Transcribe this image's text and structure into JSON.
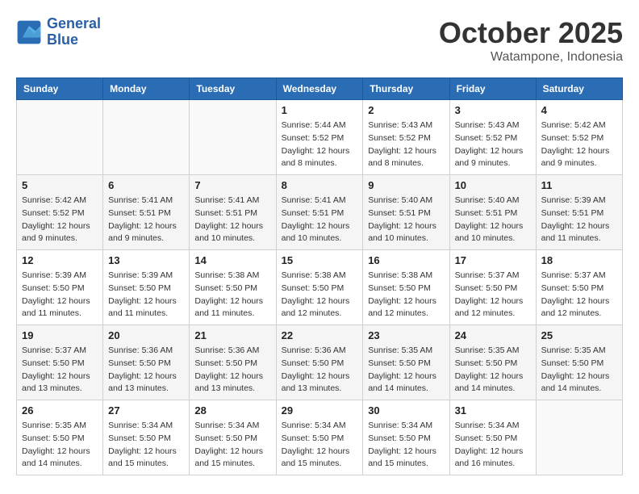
{
  "header": {
    "logo_line1": "General",
    "logo_line2": "Blue",
    "month_title": "October 2025",
    "location": "Watampone, Indonesia"
  },
  "weekdays": [
    "Sunday",
    "Monday",
    "Tuesday",
    "Wednesday",
    "Thursday",
    "Friday",
    "Saturday"
  ],
  "weeks": [
    [
      {
        "day": "",
        "info": ""
      },
      {
        "day": "",
        "info": ""
      },
      {
        "day": "",
        "info": ""
      },
      {
        "day": "1",
        "info": "Sunrise: 5:44 AM\nSunset: 5:52 PM\nDaylight: 12 hours\nand 8 minutes."
      },
      {
        "day": "2",
        "info": "Sunrise: 5:43 AM\nSunset: 5:52 PM\nDaylight: 12 hours\nand 8 minutes."
      },
      {
        "day": "3",
        "info": "Sunrise: 5:43 AM\nSunset: 5:52 PM\nDaylight: 12 hours\nand 9 minutes."
      },
      {
        "day": "4",
        "info": "Sunrise: 5:42 AM\nSunset: 5:52 PM\nDaylight: 12 hours\nand 9 minutes."
      }
    ],
    [
      {
        "day": "5",
        "info": "Sunrise: 5:42 AM\nSunset: 5:52 PM\nDaylight: 12 hours\nand 9 minutes."
      },
      {
        "day": "6",
        "info": "Sunrise: 5:41 AM\nSunset: 5:51 PM\nDaylight: 12 hours\nand 9 minutes."
      },
      {
        "day": "7",
        "info": "Sunrise: 5:41 AM\nSunset: 5:51 PM\nDaylight: 12 hours\nand 10 minutes."
      },
      {
        "day": "8",
        "info": "Sunrise: 5:41 AM\nSunset: 5:51 PM\nDaylight: 12 hours\nand 10 minutes."
      },
      {
        "day": "9",
        "info": "Sunrise: 5:40 AM\nSunset: 5:51 PM\nDaylight: 12 hours\nand 10 minutes."
      },
      {
        "day": "10",
        "info": "Sunrise: 5:40 AM\nSunset: 5:51 PM\nDaylight: 12 hours\nand 10 minutes."
      },
      {
        "day": "11",
        "info": "Sunrise: 5:39 AM\nSunset: 5:51 PM\nDaylight: 12 hours\nand 11 minutes."
      }
    ],
    [
      {
        "day": "12",
        "info": "Sunrise: 5:39 AM\nSunset: 5:50 PM\nDaylight: 12 hours\nand 11 minutes."
      },
      {
        "day": "13",
        "info": "Sunrise: 5:39 AM\nSunset: 5:50 PM\nDaylight: 12 hours\nand 11 minutes."
      },
      {
        "day": "14",
        "info": "Sunrise: 5:38 AM\nSunset: 5:50 PM\nDaylight: 12 hours\nand 11 minutes."
      },
      {
        "day": "15",
        "info": "Sunrise: 5:38 AM\nSunset: 5:50 PM\nDaylight: 12 hours\nand 12 minutes."
      },
      {
        "day": "16",
        "info": "Sunrise: 5:38 AM\nSunset: 5:50 PM\nDaylight: 12 hours\nand 12 minutes."
      },
      {
        "day": "17",
        "info": "Sunrise: 5:37 AM\nSunset: 5:50 PM\nDaylight: 12 hours\nand 12 minutes."
      },
      {
        "day": "18",
        "info": "Sunrise: 5:37 AM\nSunset: 5:50 PM\nDaylight: 12 hours\nand 12 minutes."
      }
    ],
    [
      {
        "day": "19",
        "info": "Sunrise: 5:37 AM\nSunset: 5:50 PM\nDaylight: 12 hours\nand 13 minutes."
      },
      {
        "day": "20",
        "info": "Sunrise: 5:36 AM\nSunset: 5:50 PM\nDaylight: 12 hours\nand 13 minutes."
      },
      {
        "day": "21",
        "info": "Sunrise: 5:36 AM\nSunset: 5:50 PM\nDaylight: 12 hours\nand 13 minutes."
      },
      {
        "day": "22",
        "info": "Sunrise: 5:36 AM\nSunset: 5:50 PM\nDaylight: 12 hours\nand 13 minutes."
      },
      {
        "day": "23",
        "info": "Sunrise: 5:35 AM\nSunset: 5:50 PM\nDaylight: 12 hours\nand 14 minutes."
      },
      {
        "day": "24",
        "info": "Sunrise: 5:35 AM\nSunset: 5:50 PM\nDaylight: 12 hours\nand 14 minutes."
      },
      {
        "day": "25",
        "info": "Sunrise: 5:35 AM\nSunset: 5:50 PM\nDaylight: 12 hours\nand 14 minutes."
      }
    ],
    [
      {
        "day": "26",
        "info": "Sunrise: 5:35 AM\nSunset: 5:50 PM\nDaylight: 12 hours\nand 14 minutes."
      },
      {
        "day": "27",
        "info": "Sunrise: 5:34 AM\nSunset: 5:50 PM\nDaylight: 12 hours\nand 15 minutes."
      },
      {
        "day": "28",
        "info": "Sunrise: 5:34 AM\nSunset: 5:50 PM\nDaylight: 12 hours\nand 15 minutes."
      },
      {
        "day": "29",
        "info": "Sunrise: 5:34 AM\nSunset: 5:50 PM\nDaylight: 12 hours\nand 15 minutes."
      },
      {
        "day": "30",
        "info": "Sunrise: 5:34 AM\nSunset: 5:50 PM\nDaylight: 12 hours\nand 15 minutes."
      },
      {
        "day": "31",
        "info": "Sunrise: 5:34 AM\nSunset: 5:50 PM\nDaylight: 12 hours\nand 16 minutes."
      },
      {
        "day": "",
        "info": ""
      }
    ]
  ]
}
